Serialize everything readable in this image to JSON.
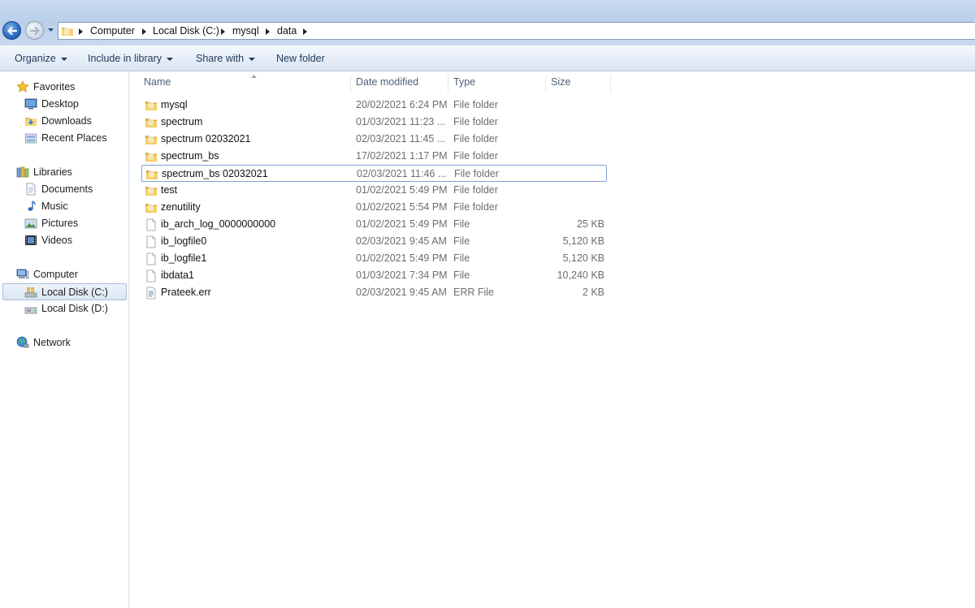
{
  "address_bar": {
    "breadcrumbs": [
      "Computer",
      "Local Disk (C:)",
      "mysql",
      "data"
    ]
  },
  "toolbar": {
    "organize": "Organize",
    "include_in_library": "Include in library",
    "share_with": "Share with",
    "new_folder": "New folder"
  },
  "sidebar": {
    "favorites": {
      "label": "Favorites",
      "items": [
        "Desktop",
        "Downloads",
        "Recent Places"
      ]
    },
    "libraries": {
      "label": "Libraries",
      "items": [
        "Documents",
        "Music",
        "Pictures",
        "Videos"
      ]
    },
    "computer": {
      "label": "Computer",
      "items": [
        "Local Disk (C:)",
        "Local Disk (D:)"
      ],
      "selected": "Local Disk (C:)"
    },
    "network": {
      "label": "Network"
    }
  },
  "columns": {
    "name": "Name",
    "date_modified": "Date modified",
    "type": "Type",
    "size": "Size"
  },
  "files": [
    {
      "name": "mysql",
      "date": "20/02/2021 6:24 PM",
      "type": "File folder",
      "size": "",
      "icon": "folder-icon"
    },
    {
      "name": "spectrum",
      "date": "01/03/2021 11:23 ...",
      "type": "File folder",
      "size": "",
      "icon": "folder-icon"
    },
    {
      "name": "spectrum 02032021",
      "date": "02/03/2021 11:45 ...",
      "type": "File folder",
      "size": "",
      "icon": "folder-icon"
    },
    {
      "name": "spectrum_bs",
      "date": "17/02/2021 1:17 PM",
      "type": "File folder",
      "size": "",
      "icon": "folder-icon"
    },
    {
      "name": "spectrum_bs 02032021",
      "date": "02/03/2021 11:46 ...",
      "type": "File folder",
      "size": "",
      "icon": "folder-icon",
      "focused": true
    },
    {
      "name": "test",
      "date": "01/02/2021 5:49 PM",
      "type": "File folder",
      "size": "",
      "icon": "folder-icon"
    },
    {
      "name": "zenutility",
      "date": "01/02/2021 5:54 PM",
      "type": "File folder",
      "size": "",
      "icon": "folder-icon"
    },
    {
      "name": "ib_arch_log_0000000000",
      "date": "01/02/2021 5:49 PM",
      "type": "File",
      "size": "25 KB",
      "icon": "file-icon"
    },
    {
      "name": "ib_logfile0",
      "date": "02/03/2021 9:45 AM",
      "type": "File",
      "size": "5,120 KB",
      "icon": "file-icon"
    },
    {
      "name": "ib_logfile1",
      "date": "01/02/2021 5:49 PM",
      "type": "File",
      "size": "5,120 KB",
      "icon": "file-icon"
    },
    {
      "name": "ibdata1",
      "date": "01/03/2021 7:34 PM",
      "type": "File",
      "size": "10,240 KB",
      "icon": "file-icon"
    },
    {
      "name": "Prateek.err",
      "date": "02/03/2021 9:45 AM",
      "type": "ERR File",
      "size": "2 KB",
      "icon": "text-file-icon"
    }
  ]
}
